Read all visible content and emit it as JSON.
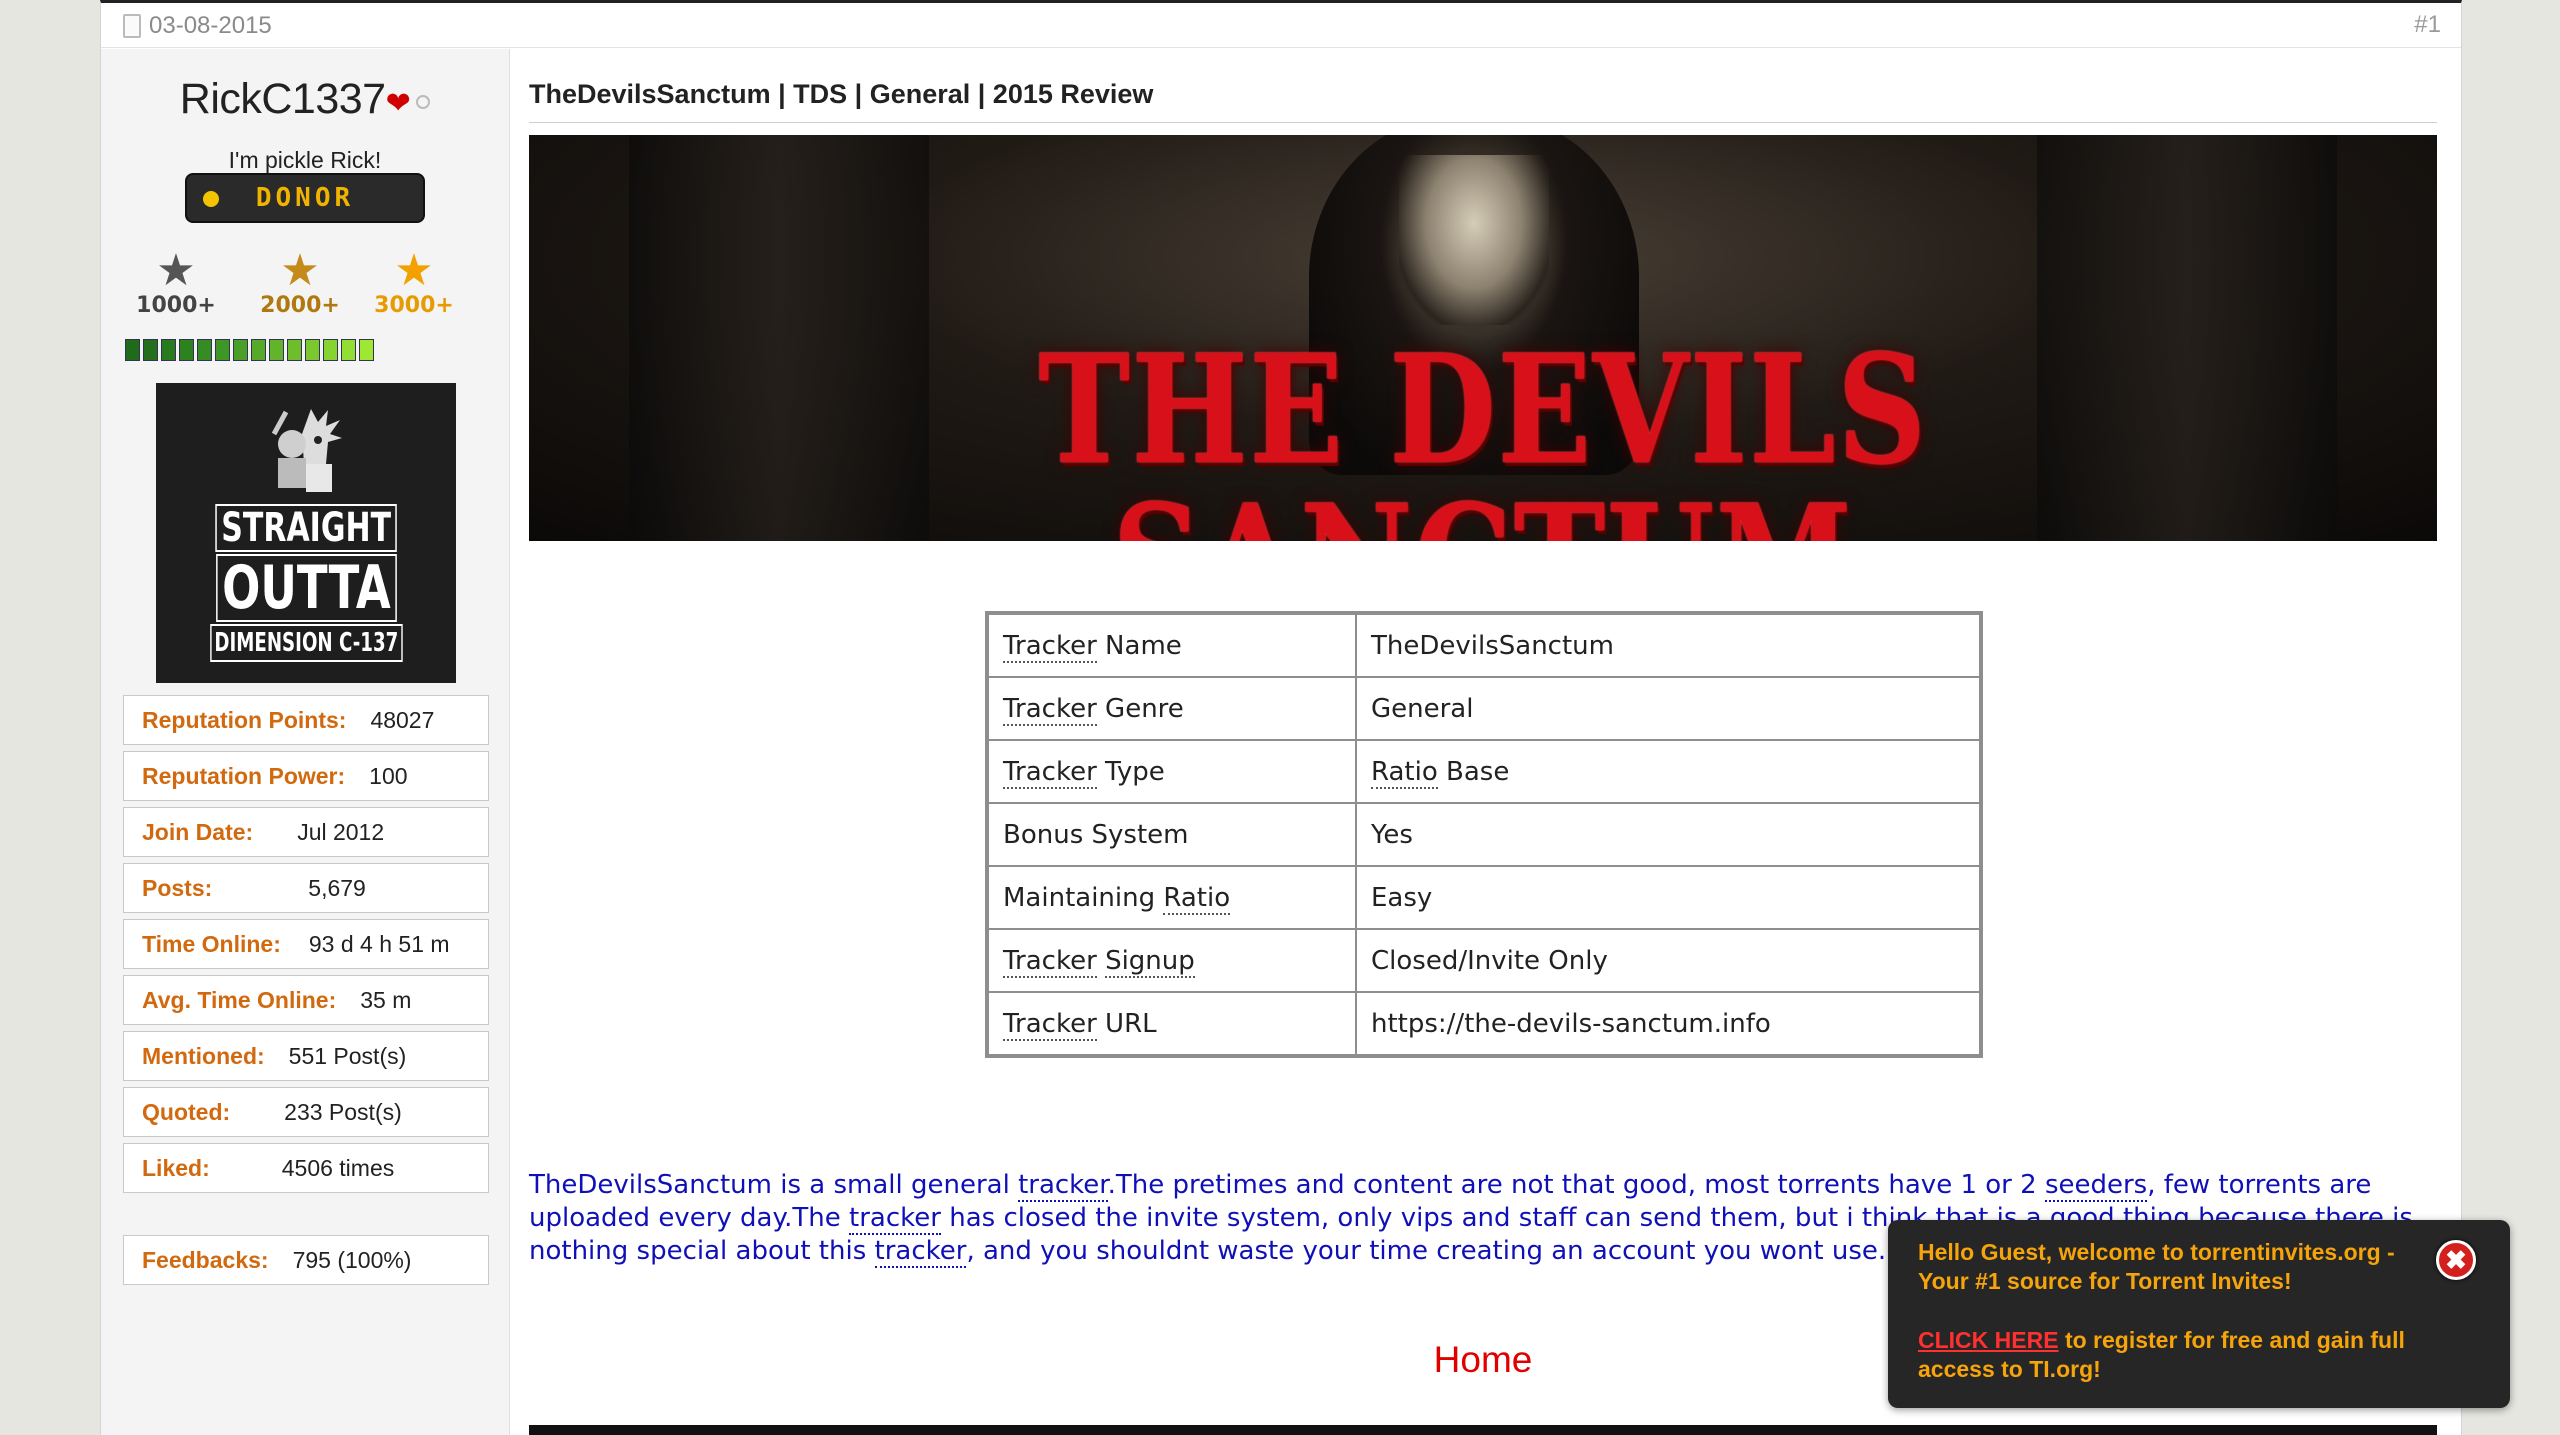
{
  "post": {
    "date": "03-08-2015",
    "number": "#1",
    "title": "TheDevilsSanctum | TDS | General | 2015 Review"
  },
  "user": {
    "name": "RickC1337",
    "title": "I'm pickle Rick!",
    "donor_label": "DONOR",
    "ranks": [
      "1000+",
      "2000+",
      "3000+"
    ],
    "avatar_text": [
      "STRAIGHT",
      "OUTTA",
      "DIMENSION C-137"
    ],
    "stats": [
      {
        "key": "Reputation Points:",
        "value": "48027"
      },
      {
        "key": "Reputation Power:",
        "value": "100"
      },
      {
        "key": "Join Date:",
        "value": "Jul 2012"
      },
      {
        "key": "Posts:",
        "value": "5,679"
      },
      {
        "key": "Time Online:",
        "value": "93 d 4 h 51 m"
      },
      {
        "key": "Avg. Time Online:",
        "value": "35 m"
      },
      {
        "key": "Mentioned:",
        "value": "551 Post(s)"
      },
      {
        "key": "Quoted:",
        "value": "233 Post(s)"
      },
      {
        "key": "Liked:",
        "value": "4506 times"
      }
    ],
    "feedbacks": {
      "key": "Feedbacks:",
      "value": "795 (100%)"
    }
  },
  "banner_text": "THE DEVILS SANCTUM",
  "tracker_table": [
    {
      "k1": "Tracker",
      "k2": " Name",
      "v": "TheDevilsSanctum"
    },
    {
      "k1": "Tracker",
      "k2": " Genre",
      "v": "General"
    },
    {
      "k1": "Tracker",
      "k2": " Type",
      "v1": "Ratio",
      "v2": " Base"
    },
    {
      "k": "Bonus System",
      "v": "Yes"
    },
    {
      "k0": "Maintaining ",
      "k1": "Ratio",
      "v": "Easy"
    },
    {
      "k1": "Tracker",
      "k2": " ",
      "k3": "Signup",
      "v": "Closed/Invite Only"
    },
    {
      "k1": "Tracker",
      "k2": " URL",
      "v": "https://the-devils-sanctum.info"
    }
  ],
  "body": {
    "p1": "TheDevilsSanctum is a small general ",
    "l1": "tracker",
    "p2": ".The pretimes and content are not that good, most torrents have 1 or 2 ",
    "l2": "seeders",
    "p3": ", few torrents are uploaded every day.The ",
    "l3": "tracker",
    "p4": " has closed the invite system, only vips and staff can send them, but i think that is a good thing because there is nothing special about this ",
    "l4": "tracker",
    "p5": ", and you shouldnt waste your time creating an account you wont use."
  },
  "home_link": "Home",
  "popup": {
    "message": "Hello Guest, welcome to torrentinvites.org - Your #1 source for Torrent Invites!",
    "cta_link": "CLICK HERE",
    "cta_text": " to register for free and gain full access to TI.org!",
    "close": "✖"
  },
  "colors": {
    "stat_key": "#d2690e",
    "body_text": "#1010b8",
    "home_link": "#e00000",
    "popup_text": "#f5a40c",
    "popup_link": "#ff3030"
  }
}
